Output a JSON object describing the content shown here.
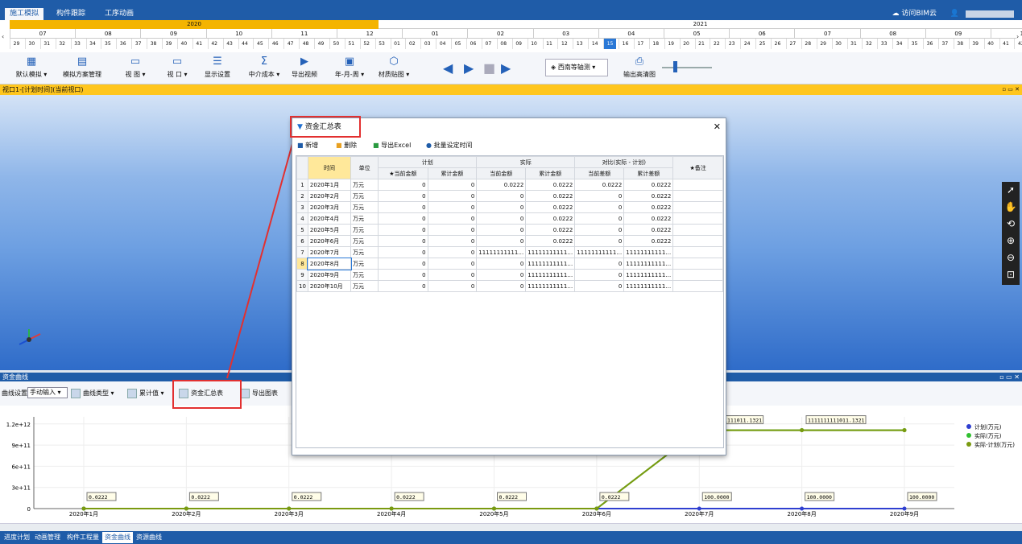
{
  "app": {
    "tabs": [
      {
        "label": "施工模拟",
        "active": true
      },
      {
        "label": "构件跟踪",
        "active": false
      },
      {
        "label": "工序动画",
        "active": false
      }
    ],
    "cloud_label": "访问BIM云"
  },
  "timeline": {
    "years": [
      "2020",
      "2021"
    ],
    "months": [
      "07",
      "08",
      "09",
      "10",
      "11",
      "12",
      "01",
      "02",
      "03",
      "04",
      "05",
      "06",
      "07",
      "08",
      "09",
      "10"
    ],
    "weeks": [
      "29",
      "30",
      "31",
      "32",
      "33",
      "34",
      "35",
      "36",
      "37",
      "38",
      "39",
      "40",
      "41",
      "42",
      "43",
      "44",
      "45",
      "46",
      "47",
      "48",
      "49",
      "50",
      "51",
      "52",
      "53",
      "01",
      "02",
      "03",
      "04",
      "05",
      "06",
      "07",
      "08",
      "09",
      "10",
      "11",
      "12",
      "13",
      "14",
      "15",
      "16",
      "17",
      "18",
      "19",
      "20",
      "21",
      "22",
      "23",
      "24",
      "25",
      "26",
      "27",
      "28",
      "29",
      "30",
      "31",
      "32",
      "33",
      "34",
      "35",
      "36",
      "37",
      "38",
      "39",
      "40",
      "41",
      "42"
    ],
    "selected_week": "15"
  },
  "toolbar": {
    "default_sim": "默认模拟",
    "sim_plan": "模拟方案管理",
    "view": "视 图",
    "window": "视 口",
    "display": "显示设置",
    "cost": "中介成本",
    "export_video": "导出视频",
    "period": "年-月-周",
    "material": "材质贴图",
    "view_mode": "西南等轴测",
    "export_hd": "输出高清图"
  },
  "viewport": {
    "title": "视口1-[计划时间](当前视口)"
  },
  "chart_panel": {
    "title": "资金曲线",
    "curve_settings": "曲线设置",
    "manual_input": "手动输入",
    "curve_type": "曲线类型",
    "cumulative": "累计值",
    "fund_summary": "资金汇总表",
    "export_chart": "导出图表"
  },
  "dialog": {
    "title": "资金汇总表",
    "tools": {
      "add": "新增",
      "delete": "删除",
      "export_excel": "导出Excel",
      "batch_time": "批量设定时间"
    },
    "headers": {
      "time": "时间",
      "unit": "单位",
      "plan": "计划",
      "actual": "实际",
      "compare": "对比(实际 - 计划)",
      "remark": "★备注",
      "plan_current": "★当前金额",
      "plan_cum": "累计金额",
      "act_current": "当前金额",
      "act_cum": "累计金额",
      "cmp_current": "当前差额",
      "cmp_cum": "累计差额"
    },
    "rows": [
      {
        "n": "1",
        "time": "2020年1月",
        "unit": "万元",
        "p1": "0",
        "p2": "0",
        "a1": "0.0222",
        "a2": "0.0222",
        "c1": "0.0222",
        "c2": "0.0222"
      },
      {
        "n": "2",
        "time": "2020年2月",
        "unit": "万元",
        "p1": "0",
        "p2": "0",
        "a1": "0",
        "a2": "0.0222",
        "c1": "0",
        "c2": "0.0222"
      },
      {
        "n": "3",
        "time": "2020年3月",
        "unit": "万元",
        "p1": "0",
        "p2": "0",
        "a1": "0",
        "a2": "0.0222",
        "c1": "0",
        "c2": "0.0222"
      },
      {
        "n": "4",
        "time": "2020年4月",
        "unit": "万元",
        "p1": "0",
        "p2": "0",
        "a1": "0",
        "a2": "0.0222",
        "c1": "0",
        "c2": "0.0222"
      },
      {
        "n": "5",
        "time": "2020年5月",
        "unit": "万元",
        "p1": "0",
        "p2": "0",
        "a1": "0",
        "a2": "0.0222",
        "c1": "0",
        "c2": "0.0222"
      },
      {
        "n": "6",
        "time": "2020年6月",
        "unit": "万元",
        "p1": "0",
        "p2": "0",
        "a1": "0",
        "a2": "0.0222",
        "c1": "0",
        "c2": "0.0222"
      },
      {
        "n": "7",
        "time": "2020年7月",
        "unit": "万元",
        "p1": "0",
        "p2": "0",
        "a1": "11111111111…",
        "a2": "11111111111…",
        "c1": "11111111111…",
        "c2": "11111111111…"
      },
      {
        "n": "8",
        "time": "2020年8月",
        "unit": "万元",
        "p1": "0",
        "p2": "0",
        "a1": "0",
        "a2": "11111111111…",
        "c1": "0",
        "c2": "11111111111…"
      },
      {
        "n": "9",
        "time": "2020年9月",
        "unit": "万元",
        "p1": "0",
        "p2": "0",
        "a1": "0",
        "a2": "11111111111…",
        "c1": "0",
        "c2": "11111111111…"
      },
      {
        "n": "10",
        "time": "2020年10月",
        "unit": "万元",
        "p1": "0",
        "p2": "0",
        "a1": "0",
        "a2": "11111111111…",
        "c1": "0",
        "c2": "11111111111…"
      }
    ]
  },
  "chart_data": {
    "type": "line",
    "categories": [
      "2020年1月",
      "2020年2月",
      "2020年3月",
      "2020年4月",
      "2020年5月",
      "2020年6月",
      "2020年7月",
      "2020年8月",
      "2020年9月"
    ],
    "yticks": [
      "0",
      "3e+11",
      "6e+11",
      "9e+11",
      "1.2e+12"
    ],
    "ylim": [
      0,
      1300000000000
    ],
    "series": [
      {
        "name": "计划(万元)",
        "color": "#2f3fd0",
        "values": [
          0,
          0,
          0,
          0,
          0,
          0,
          0,
          0,
          0
        ]
      },
      {
        "name": "实际(万元)",
        "color": "#30c030",
        "values": [
          0.0222,
          0.0222,
          0.0222,
          0.0222,
          0.0222,
          0.0222,
          1111111111011.132,
          1111111111011.132,
          1111111111011.132
        ]
      },
      {
        "name": "实际-计划(万元)",
        "color": "#7a9a10",
        "values": [
          0.0222,
          0.0222,
          0.0222,
          0.0222,
          0.0222,
          0.0222,
          1111111111011.132,
          1111111111011.132,
          1111111111011.132
        ]
      }
    ],
    "labels_low": [
      "0.0222",
      "0.0222",
      "0.0222",
      "0.0222",
      "0.0222",
      "0.0222",
      "100.0000",
      "100.0000",
      "100.0000"
    ],
    "labels_high": [
      "1011.1321",
      "1111111111011.1321",
      "1111111111011.1321"
    ]
  },
  "statusbar": {
    "items": [
      {
        "label": "进度计划",
        "active": false
      },
      {
        "label": "动画管理",
        "active": false
      },
      {
        "label": "构件工程量",
        "active": false
      },
      {
        "label": "资金曲线",
        "active": true
      },
      {
        "label": "资源曲线",
        "active": false
      }
    ]
  }
}
